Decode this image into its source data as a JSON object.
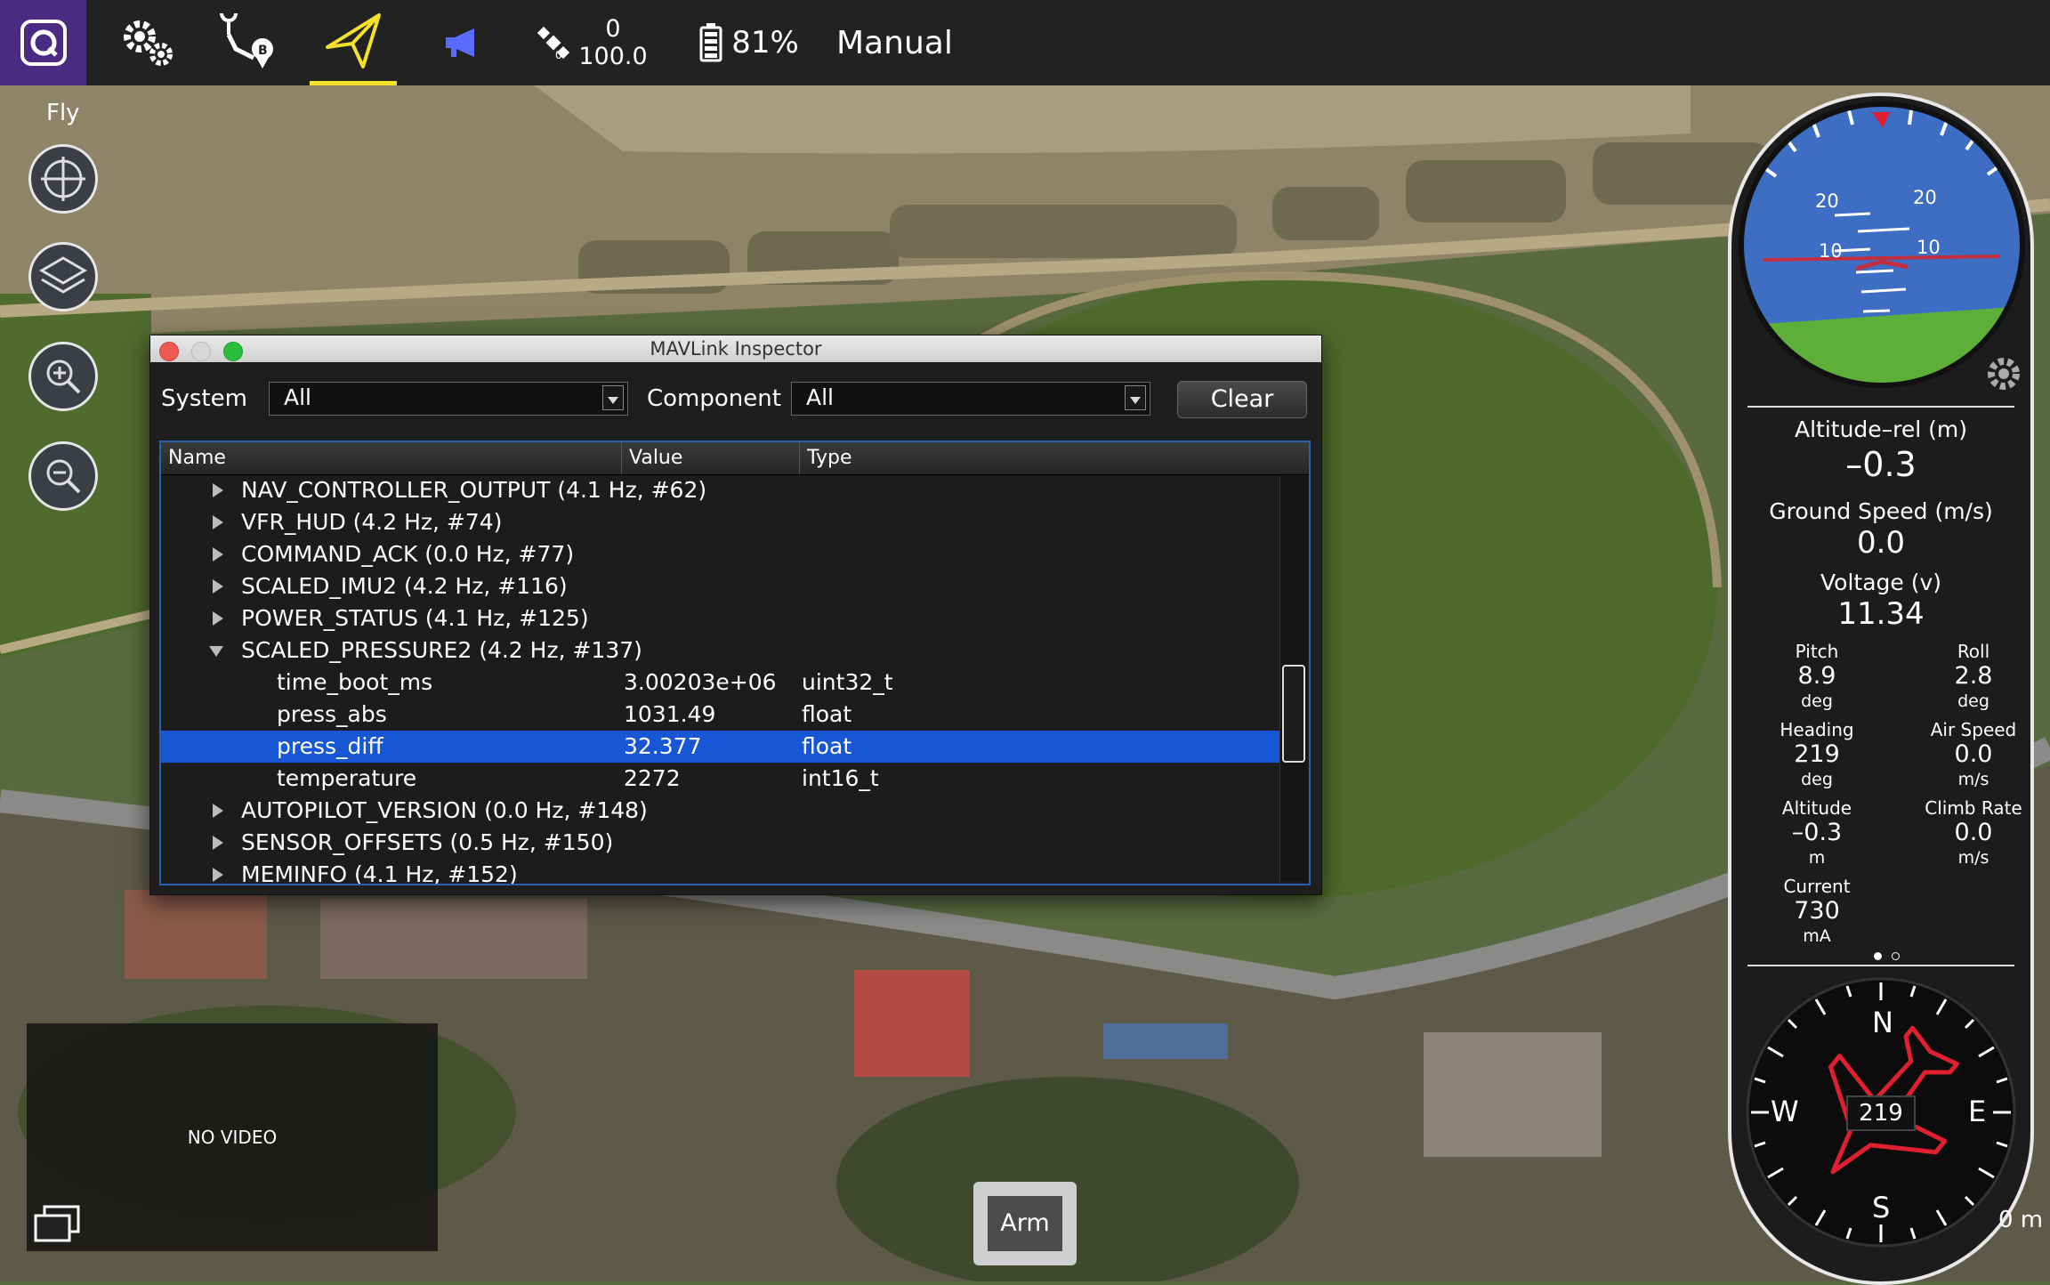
{
  "toolbar": {
    "gps_count": "0",
    "gps_hdop": "100.0",
    "battery": "81%",
    "flight_mode": "Manual"
  },
  "fly_tools": {
    "label": "Fly"
  },
  "inspector": {
    "title": "MAVLink Inspector",
    "system_label": "System",
    "system_value": "All",
    "component_label": "Component",
    "component_value": "All",
    "clear_label": "Clear",
    "columns": [
      "Name",
      "Value",
      "Type"
    ],
    "rows": [
      {
        "name": "NAV_CONTROLLER_OUTPUT (4.1 Hz, #62)"
      },
      {
        "name": "VFR_HUD (4.2 Hz, #74)"
      },
      {
        "name": "COMMAND_ACK (0.0 Hz, #77)"
      },
      {
        "name": "SCALED_IMU2 (4.2 Hz, #116)"
      },
      {
        "name": "POWER_STATUS (4.1 Hz, #125)"
      },
      {
        "name": "SCALED_PRESSURE2 (4.2 Hz, #137)"
      },
      {
        "name": "time_boot_ms",
        "value": "3.00203e+06",
        "type": "uint32_t"
      },
      {
        "name": "press_abs",
        "value": "1031.49",
        "type": "float"
      },
      {
        "name": "press_diff",
        "value": "32.377",
        "type": "float"
      },
      {
        "name": "temperature",
        "value": "2272",
        "type": "int16_t"
      },
      {
        "name": "AUTOPILOT_VERSION (0.0 Hz, #148)"
      },
      {
        "name": "SENSOR_OFFSETS (0.5 Hz, #150)"
      },
      {
        "name": "MEMINFO (4.1 Hz, #152)"
      }
    ]
  },
  "video": {
    "no_video": "NO VIDEO"
  },
  "arm": {
    "label": "Arm"
  },
  "attitude": {
    "pitch_ticks": [
      "20",
      "20",
      "10",
      "10"
    ]
  },
  "instruments": {
    "alt_rel_label": "Altitude–rel (m)",
    "alt_rel_value": "–0.3",
    "ground_speed_label": "Ground Speed (m/s)",
    "ground_speed_value": "0.0",
    "voltage_label": "Voltage (v)",
    "voltage_value": "11.34",
    "pitch": {
      "label": "Pitch",
      "value": "8.9",
      "unit": "deg"
    },
    "roll": {
      "label": "Roll",
      "value": "2.8",
      "unit": "deg"
    },
    "heading": {
      "label": "Heading",
      "value": "219",
      "unit": "deg"
    },
    "air_speed": {
      "label": "Air Speed",
      "value": "0.0",
      "unit": "m/s"
    },
    "altitude": {
      "label": "Altitude",
      "value": "–0.3",
      "unit": "m"
    },
    "climb_rate": {
      "label": "Climb Rate",
      "value": "0.0",
      "unit": "m/s"
    },
    "current": {
      "label": "Current",
      "value": "730",
      "unit": "mA"
    }
  },
  "compass": {
    "heading": "219",
    "north": "N",
    "south": "S",
    "east": "E",
    "west": "W"
  },
  "map": {
    "scale": "0 m"
  }
}
